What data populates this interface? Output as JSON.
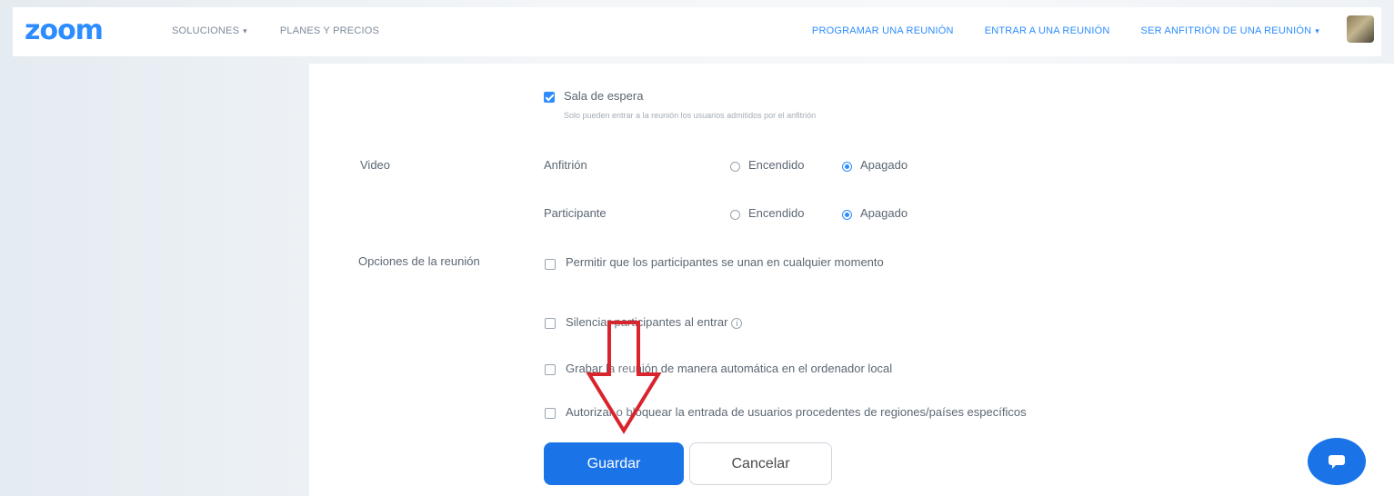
{
  "header": {
    "logo": "zoom",
    "nav_left": [
      "SOLUCIONES",
      "PLANES Y PRECIOS"
    ],
    "nav_right": [
      "PROGRAMAR UNA REUNIÓN",
      "ENTRAR A UNA REUNIÓN",
      "SER ANFITRIÓN DE UNA REUNIÓN"
    ],
    "accent": "#2d8cff"
  },
  "waiting_room": {
    "label": "Sala de espera",
    "checked": true,
    "hint": "Solo pueden entrar a la reunión los usuarios admitidos por el anfitrión"
  },
  "video": {
    "label": "Video",
    "rows": [
      {
        "name": "Anfitrión",
        "on_label": "Encendido",
        "off_label": "Apagado",
        "selected": "Apagado"
      },
      {
        "name": "Participante",
        "on_label": "Encendido",
        "off_label": "Apagado",
        "selected": "Apagado"
      }
    ]
  },
  "meeting_options": {
    "label": "Opciones de la reunión",
    "items": [
      {
        "text": "Permitir que los participantes se unan en cualquier momento",
        "checked": false
      },
      {
        "text": "Silenciar participantes al entrar",
        "checked": false
      },
      {
        "text": "Grabar la reunión de manera automática en el ordenador local",
        "checked": false
      },
      {
        "text": "Autorizar o bloquear la entrada de usuarios procedentes de regiones/países específicos",
        "checked": false
      }
    ]
  },
  "actions": {
    "save": "Guardar",
    "cancel": "Cancelar",
    "save_color": "#1a74e8"
  },
  "annotation": {
    "arrow_color": "#d9232d"
  }
}
